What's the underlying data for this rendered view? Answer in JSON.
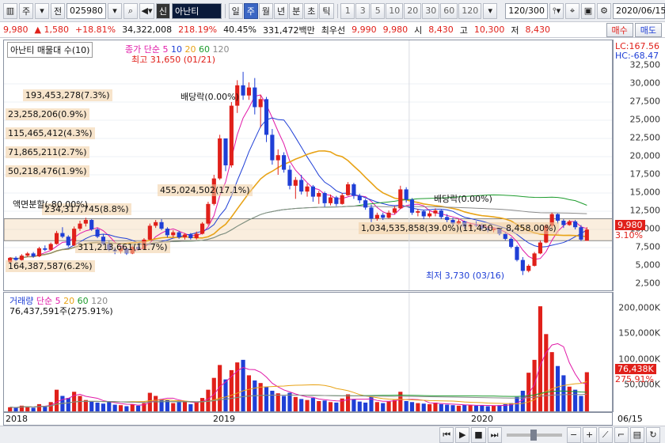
{
  "toolbar": {
    "menu_glyph": "▥",
    "market": "주",
    "type": "전",
    "code": "025980",
    "stock_tag": "신",
    "stock_name": "아난티",
    "periods": [
      "일",
      "주",
      "월",
      "년",
      "분",
      "초",
      "틱"
    ],
    "active_period": "주",
    "intervals": [
      "1",
      "3",
      "5",
      "10",
      "20",
      "30",
      "60",
      "120"
    ],
    "count_display": "120/300",
    "date": "2020/06/15"
  },
  "quote": {
    "price": "9,980",
    "change": "▲ 1,580",
    "change_pct": "+18.81%",
    "volume": "34,322,008",
    "vol_ratio": "218.19%",
    "turnover": "40.45%",
    "amount": "331,472백만",
    "best_ask_label": "최우선",
    "best_ask": "9,990",
    "best_bid": "9,980",
    "open_label": "시",
    "open": "8,430",
    "high_label": "고",
    "high": "10,300",
    "low_label": "저",
    "low": "8,430",
    "buy_label": "매수",
    "sell_label": "매도"
  },
  "price_panel": {
    "title": "아난티 매물대 수(10)",
    "ma_label": "종가 단순",
    "ma_periods": [
      "5",
      "10",
      "20",
      "60",
      "120"
    ],
    "lc": "LC:167.56",
    "hc": "HC:-68.47",
    "high_annot": "최고 31,650 (01/21)",
    "low_annot": "최저 3,730 (03/16)",
    "div_annot_1": "배당락(0.00%)",
    "div_annot_2": "배당락(0.00%)",
    "split_annot": "액면분할(-80.00%)",
    "current_price_tag": "9,980",
    "current_pct_tag": "3.10%",
    "volume_profile": [
      {
        "label": "193,453,278(7.3%)"
      },
      {
        "label": "23,258,206(0.9%)"
      },
      {
        "label": "115,465,412(4.3%)"
      },
      {
        "label": "71,865,211(2.7%)"
      },
      {
        "label": "50,218,476(1.9%)"
      },
      {
        "label": "455,024,502(17.1%)"
      },
      {
        "label": "234,317,745(8.8%)"
      },
      {
        "label": "1,034,535,858(39.0%)(11,450 ~ 8,458.00%)"
      },
      {
        "label": "311,213,661(11.7%)"
      },
      {
        "label": "164,387,587(6.2%)"
      }
    ],
    "y_ticks": [
      "32,500",
      "30,000",
      "27,500",
      "25,000",
      "22,500",
      "20,000",
      "17,500",
      "15,000",
      "12,500",
      "10,000",
      "7,500",
      "5,000",
      "2,500"
    ]
  },
  "volume_panel": {
    "title": "거래량",
    "ma_label": "단순",
    "ma_periods": [
      "5",
      "20",
      "60",
      "120"
    ],
    "current_text": "76,437,591주(275.91%)",
    "y_ticks": [
      "200,000K",
      "150,000K",
      "100,000K",
      "50,000K"
    ],
    "tag_value": "76,438K",
    "tag_pct": "275.91%"
  },
  "x_axis": {
    "labels": [
      "2018",
      "2019",
      "2020"
    ],
    "end_label": "06/15"
  },
  "colors": {
    "up": "#e0201a",
    "down": "#1f3fd6",
    "ma5": "#e11aa8",
    "ma10": "#1f3fd6",
    "ma20": "#e8a317",
    "ma60": "#1e9c2e",
    "ma120": "#8a8a8a"
  },
  "chart_data": {
    "type": "candlestick",
    "candles": [
      [
        5500,
        6200,
        5400,
        6100
      ],
      [
        6100,
        6300,
        5600,
        5800
      ],
      [
        5800,
        6600,
        5700,
        6400
      ],
      [
        6400,
        6900,
        6200,
        6700
      ],
      [
        6700,
        6900,
        6100,
        6300
      ],
      [
        6300,
        7600,
        6200,
        7400
      ],
      [
        7400,
        7800,
        7000,
        7200
      ],
      [
        7200,
        8200,
        7100,
        8000
      ],
      [
        8000,
        9800,
        7900,
        9500
      ],
      [
        9500,
        10300,
        8800,
        9000
      ],
      [
        9000,
        9200,
        7600,
        7800
      ],
      [
        7800,
        10400,
        7700,
        10100
      ],
      [
        10100,
        11200,
        9800,
        10800
      ],
      [
        10800,
        11600,
        10400,
        11300
      ],
      [
        11300,
        11400,
        9800,
        10000
      ],
      [
        10000,
        10200,
        8800,
        9000
      ],
      [
        9000,
        9300,
        7800,
        8000
      ],
      [
        8000,
        8400,
        7000,
        7200
      ],
      [
        7200,
        7600,
        6600,
        7000
      ],
      [
        7000,
        7600,
        6700,
        7400
      ],
      [
        7400,
        7500,
        6500,
        6700
      ],
      [
        6700,
        7800,
        6600,
        7600
      ],
      [
        7600,
        7900,
        7100,
        7300
      ],
      [
        7300,
        8800,
        7200,
        8600
      ],
      [
        8600,
        10800,
        8500,
        10500
      ],
      [
        10500,
        11300,
        10200,
        11000
      ],
      [
        11000,
        11400,
        9900,
        10100
      ],
      [
        10100,
        10300,
        8900,
        9200
      ],
      [
        9200,
        9900,
        8900,
        9600
      ],
      [
        9600,
        9800,
        8700,
        8900
      ],
      [
        8900,
        9500,
        8600,
        9300
      ],
      [
        9300,
        9500,
        8600,
        8800
      ],
      [
        8800,
        9700,
        8600,
        9400
      ],
      [
        9400,
        11000,
        9300,
        10800
      ],
      [
        10800,
        13800,
        10600,
        13500
      ],
      [
        13500,
        17500,
        13300,
        17000
      ],
      [
        17000,
        23000,
        16800,
        22500
      ],
      [
        22500,
        21800,
        18000,
        18800
      ],
      [
        18800,
        27500,
        18500,
        27000
      ],
      [
        27000,
        30500,
        26000,
        29800
      ],
      [
        29800,
        31650,
        27800,
        28400
      ],
      [
        28400,
        30200,
        27800,
        29500
      ],
      [
        29500,
        30800,
        25800,
        26800
      ],
      [
        26800,
        28500,
        24000,
        27900
      ],
      [
        27900,
        28200,
        22000,
        23000
      ],
      [
        23000,
        23800,
        18900,
        19500
      ],
      [
        19500,
        21000,
        17500,
        20200
      ],
      [
        20200,
        20600,
        17800,
        18200
      ],
      [
        18200,
        18800,
        15500,
        16000
      ],
      [
        16000,
        17200,
        14200,
        16800
      ],
      [
        16800,
        17500,
        14800,
        15200
      ],
      [
        15200,
        16300,
        14500,
        15900
      ],
      [
        15900,
        16100,
        13800,
        14500
      ],
      [
        14500,
        15300,
        13500,
        15000
      ],
      [
        15000,
        15200,
        13100,
        13600
      ],
      [
        13600,
        14800,
        13300,
        14400
      ],
      [
        14400,
        14600,
        13200,
        13500
      ],
      [
        13500,
        15000,
        13400,
        14700
      ],
      [
        14700,
        16500,
        14600,
        16200
      ],
      [
        16200,
        16400,
        14200,
        14600
      ],
      [
        14600,
        14900,
        13600,
        14000
      ],
      [
        14000,
        14200,
        12700,
        13000
      ],
      [
        13000,
        13400,
        11000,
        11500
      ],
      [
        11500,
        12300,
        11200,
        12000
      ],
      [
        12000,
        12300,
        11300,
        11600
      ],
      [
        11600,
        12600,
        11500,
        12300
      ],
      [
        12300,
        13200,
        12100,
        12900
      ],
      [
        12900,
        16000,
        12800,
        15500
      ],
      [
        15500,
        15800,
        13700,
        14100
      ],
      [
        14100,
        14300,
        12000,
        12300
      ],
      [
        12300,
        12800,
        11800,
        12500
      ],
      [
        12500,
        12700,
        11400,
        11800
      ],
      [
        11800,
        12500,
        11600,
        12200
      ],
      [
        12200,
        12900,
        11800,
        12600
      ],
      [
        12600,
        12700,
        11400,
        11700
      ],
      [
        11700,
        12100,
        11000,
        11300
      ],
      [
        11300,
        11600,
        10500,
        10800
      ],
      [
        10800,
        11400,
        10600,
        11100
      ],
      [
        11100,
        11200,
        10100,
        10400
      ],
      [
        10400,
        10900,
        10100,
        10600
      ],
      [
        10600,
        11100,
        10300,
        10500
      ],
      [
        10500,
        10800,
        9800,
        10100
      ],
      [
        10100,
        10400,
        9600,
        9900
      ],
      [
        9900,
        10300,
        9600,
        10100
      ],
      [
        10100,
        10200,
        9200,
        9400
      ],
      [
        9400,
        9600,
        8500,
        8700
      ],
      [
        8700,
        8900,
        7400,
        7600
      ],
      [
        7600,
        7800,
        5600,
        5800
      ],
      [
        5800,
        6200,
        3730,
        4300
      ],
      [
        4300,
        5200,
        4100,
        5000
      ],
      [
        5000,
        6900,
        4900,
        6700
      ],
      [
        6700,
        8500,
        6600,
        8200
      ],
      [
        8200,
        10700,
        8100,
        10500
      ],
      [
        10500,
        12300,
        10200,
        12100
      ],
      [
        12100,
        12200,
        10800,
        11200
      ],
      [
        11200,
        11400,
        10200,
        10600
      ],
      [
        10600,
        11300,
        10500,
        11100
      ],
      [
        11100,
        11300,
        10000,
        10300
      ],
      [
        10300,
        10600,
        8400,
        8600
      ],
      [
        8430,
        10300,
        8430,
        9980
      ]
    ],
    "volume": [
      8,
      7,
      11,
      9,
      7,
      14,
      10,
      18,
      42,
      30,
      26,
      38,
      30,
      22,
      20,
      17,
      15,
      19,
      13,
      12,
      10,
      14,
      11,
      16,
      36,
      30,
      24,
      22,
      16,
      18,
      20,
      14,
      17,
      26,
      42,
      65,
      90,
      62,
      80,
      95,
      100,
      70,
      60,
      55,
      48,
      40,
      35,
      30,
      36,
      28,
      24,
      22,
      26,
      20,
      21,
      18,
      17,
      25,
      33,
      24,
      19,
      17,
      28,
      18,
      16,
      19,
      22,
      38,
      20,
      18,
      16,
      15,
      14,
      17,
      14,
      13,
      12,
      11,
      13,
      12,
      11,
      12,
      10,
      11,
      12,
      14,
      16,
      28,
      40,
      75,
      100,
      204,
      150,
      115,
      88,
      70,
      48,
      42,
      30,
      76
    ],
    "ylim": [
      2500,
      32500
    ],
    "vol_ylim": [
      0,
      215
    ]
  }
}
